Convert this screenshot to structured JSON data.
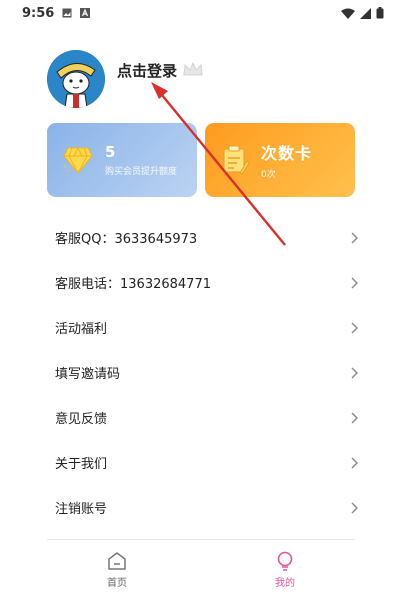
{
  "status_bar": {
    "time": "9:56"
  },
  "profile": {
    "login_text": "点击登录",
    "crown_icon": "crown-icon",
    "avatar_icon": "avatar-image"
  },
  "cards": {
    "vip": {
      "value": "5",
      "subtitle": "购买会员提升额度",
      "icon": "diamond-icon"
    },
    "count": {
      "title": "次数卡",
      "subtitle": "0次",
      "icon": "notepad-icon"
    }
  },
  "menu": [
    {
      "label": "客服QQ：3633645973"
    },
    {
      "label": "客服电话：13632684771"
    },
    {
      "label": "活动福利"
    },
    {
      "label": "填写邀请码"
    },
    {
      "label": "意见反馈"
    },
    {
      "label": "关于我们"
    },
    {
      "label": "注销账号"
    }
  ],
  "tabs": [
    {
      "label": "首页",
      "icon": "home-icon"
    },
    {
      "label": "我的",
      "icon": "lightbulb-icon",
      "active": true
    }
  ],
  "colors": {
    "accent_pink": "#e8559b",
    "card_blue": "#9ebff0",
    "card_orange": "#ffa82e",
    "arrow_red": "#d9302c"
  }
}
